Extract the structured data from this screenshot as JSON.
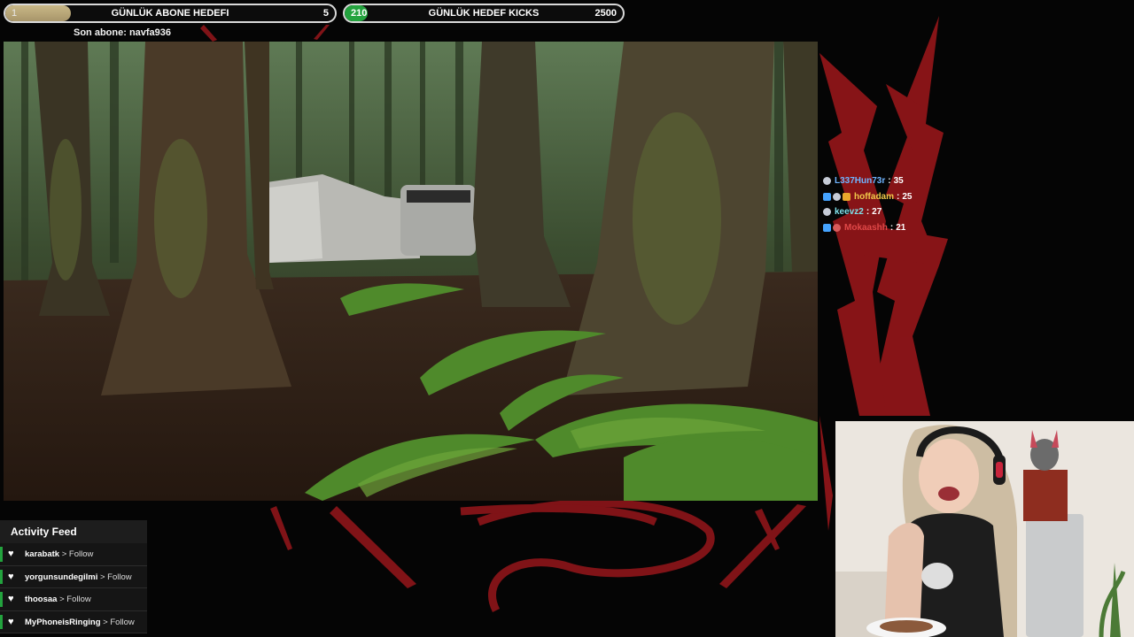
{
  "goals": {
    "subs": {
      "title": "GÜNLÜK ABONE HEDEFI",
      "current": "1",
      "target": "5",
      "progress": 0.2
    },
    "kicks": {
      "title": "GÜNLÜK HEDEF KICKS",
      "current": "210",
      "target": "2500",
      "progress": 0.084
    }
  },
  "last_sub": "Son abone: navfa936",
  "leaderboard": [
    {
      "name": "L337Hun73r",
      "count": "35",
      "name_color": "#6fb4ff"
    },
    {
      "name": "hoffadam",
      "count": "25",
      "name_color": "#f0c94a"
    },
    {
      "name": "keevz2",
      "count": "27",
      "name_color": "#7fe0e9"
    },
    {
      "name": "Mokaashh",
      "count": "21",
      "name_color": "#e04848"
    }
  ],
  "activity_feed": {
    "title": "Activity Feed",
    "items": [
      {
        "user": "karabatk",
        "action": "> Follow"
      },
      {
        "user": "yorgunsundegilmi",
        "action": "> Follow"
      },
      {
        "user": "thoosaa",
        "action": "> Follow"
      },
      {
        "user": "MyPhoneisRinging",
        "action": "> Follow"
      }
    ]
  },
  "colors": {
    "accent_red": "#b0171d",
    "accent_green": "#23a33e",
    "goal_gold": "#b7a476"
  },
  "icons": {
    "feed_item": "heart-icon",
    "leaderboard_badge": "badge-icon"
  }
}
